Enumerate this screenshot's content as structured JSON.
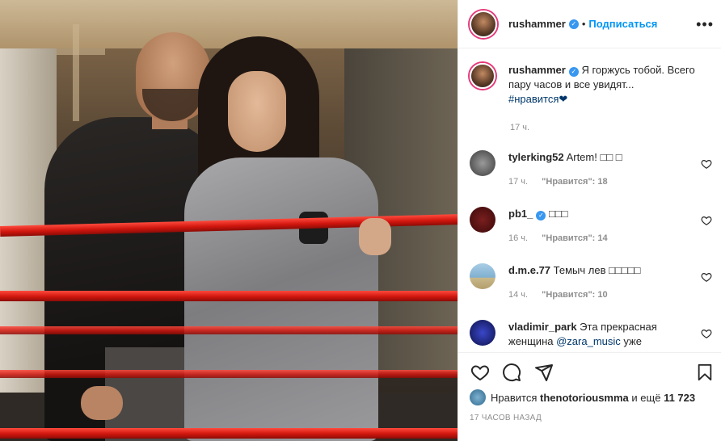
{
  "post": {
    "username": "rushammer",
    "follow_label": "Подписаться",
    "more_label": "•••",
    "caption_username": "rushammer",
    "caption_text": "Я горжусь тобой. Всего пару часов и все увидят...",
    "caption_hashtag": "#нравится",
    "caption_emoji": "❤",
    "caption_time": "17 ч."
  },
  "comments": [
    {
      "username": "tylerking52",
      "text": "Artem! □□ □",
      "time": "17 ч.",
      "likes_label": "\"Нравится\": 18",
      "avatar_color": "#6b6b6b"
    },
    {
      "username": "pb1_",
      "verified": true,
      "text": "□□□",
      "time": "16 ч.",
      "likes_label": "\"Нравится\": 14",
      "avatar_color": "#5a1212"
    },
    {
      "username": "d.m.e.77",
      "text": "Темыч лев □□□□□",
      "time": "14 ч.",
      "likes_label": "\"Нравится\": 10",
      "avatar_color": "#8fb7d3"
    },
    {
      "username": "vladimir_park",
      "text": "Эта прекрасная женщина",
      "mention": "@zara_music",
      "text_tail": "уже",
      "avatar_color": "#1a1f6b"
    }
  ],
  "footer": {
    "likes_prefix": "Нравится",
    "likes_user": "thenotoriousmma",
    "likes_middle": "и ещё",
    "likes_count": "11 723",
    "date": "17 часов назад"
  },
  "icons": {
    "like": "heart-icon",
    "comment": "comment-icon",
    "share": "paper-plane-icon",
    "save": "bookmark-icon"
  },
  "colors": {
    "accent": "#0095f6",
    "verified": "#3897f0",
    "hashtag": "#00376b",
    "rope": "#d0160e"
  }
}
